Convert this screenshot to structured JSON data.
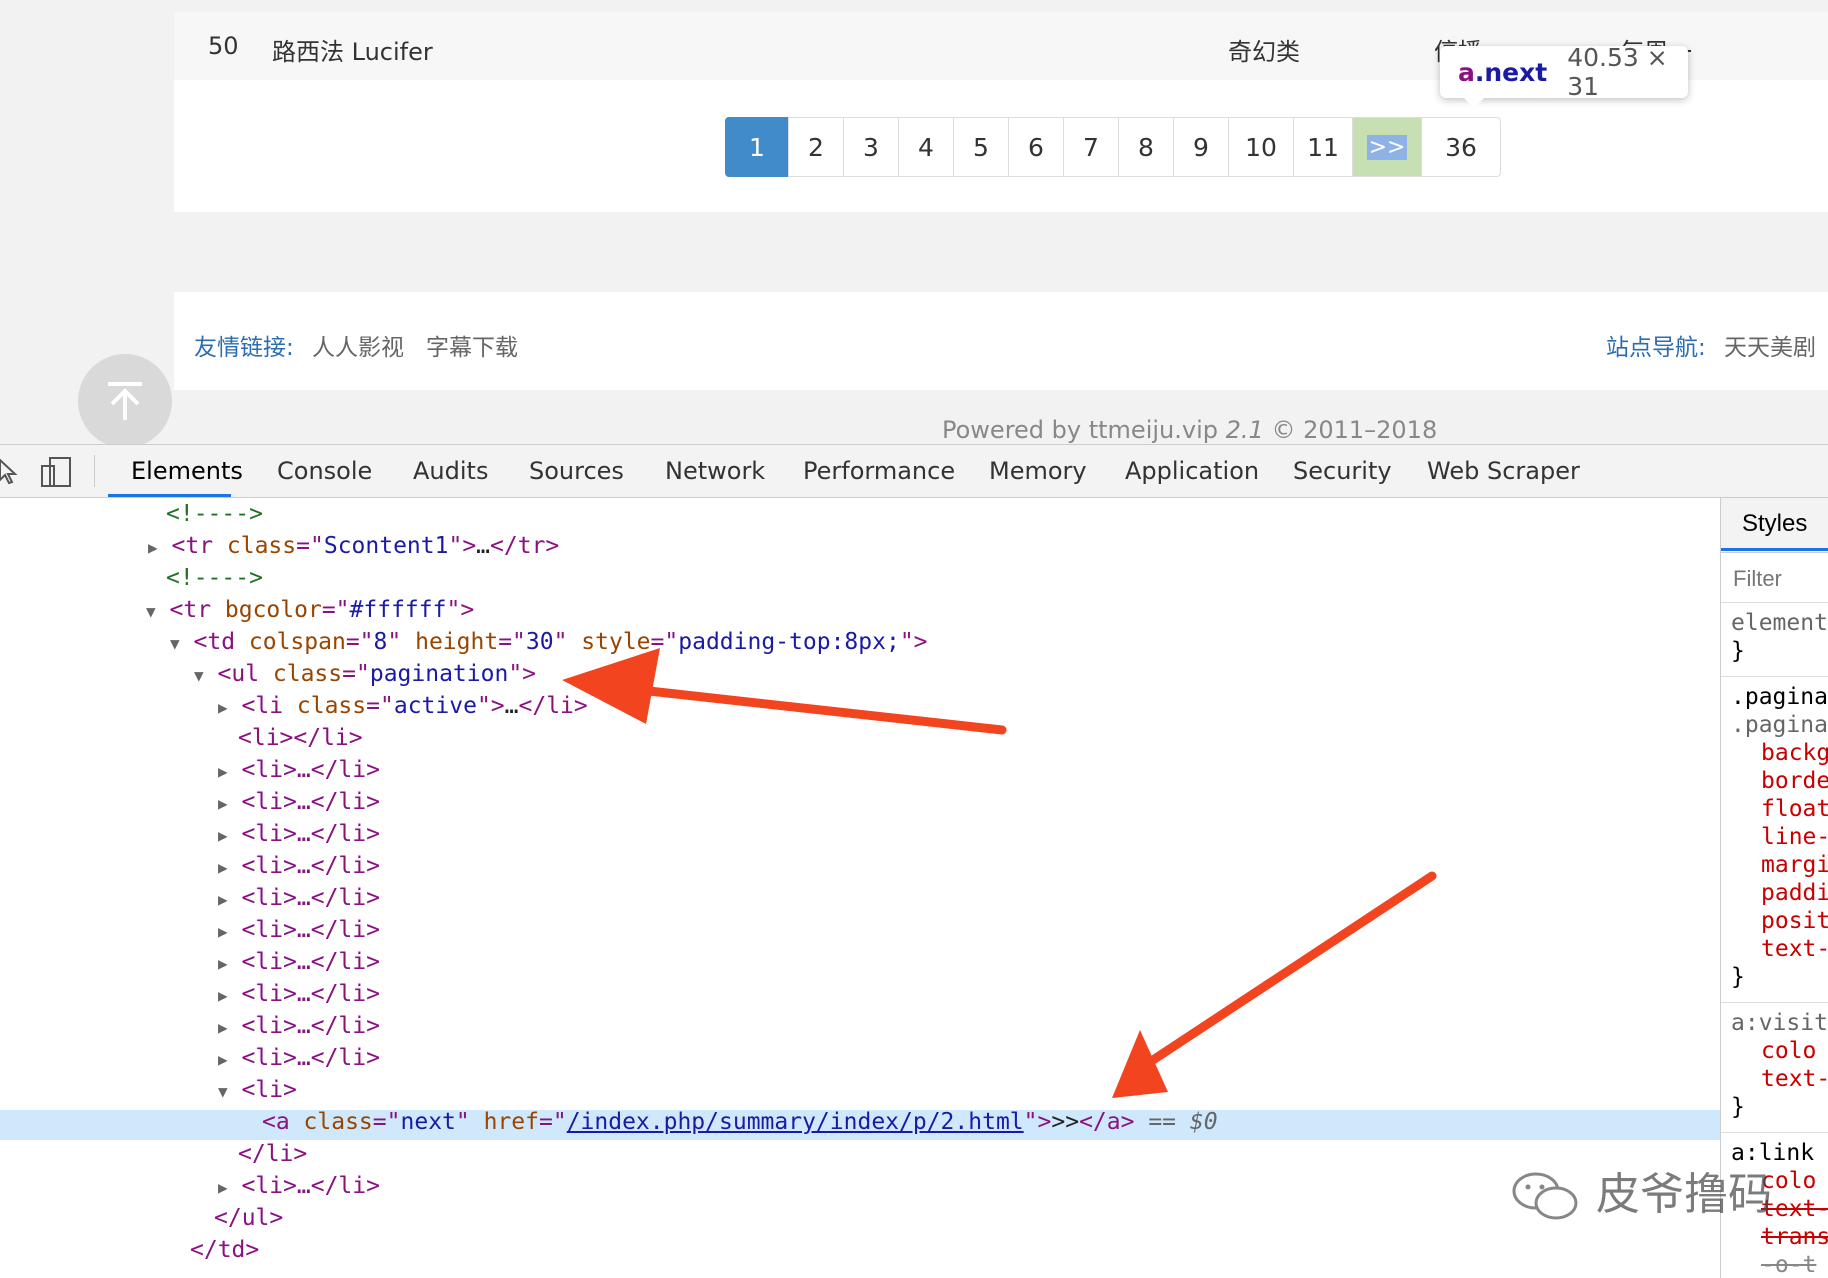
{
  "page": {
    "row": {
      "num": "50",
      "title": "路西法 Lucifer",
      "genre": "奇幻类",
      "status": "停播",
      "schedule": "每周一"
    },
    "pagination": [
      {
        "label": "1",
        "active": true
      },
      {
        "label": "2"
      },
      {
        "label": "3"
      },
      {
        "label": "4"
      },
      {
        "label": "5"
      },
      {
        "label": "6"
      },
      {
        "label": "7"
      },
      {
        "label": "8"
      },
      {
        "label": "9"
      },
      {
        "label": "10"
      },
      {
        "label": "11"
      },
      {
        "label": ">>",
        "next": true
      },
      {
        "label": "36"
      }
    ],
    "tooltip": {
      "selector_tag": "a",
      "selector_class": ".next",
      "dims": "40.53 × 31"
    },
    "friend_links_label": "友情链接:",
    "friend_links": [
      "人人影视",
      "字幕下载"
    ],
    "site_nav_label": "站点导航:",
    "site_nav": "天天美剧",
    "powered": {
      "pre": "Powered by ttmeiju.vip",
      "ver": "2.1",
      "post": "© 2011–2018"
    },
    "back_to_top_icon": "arrow-up-icon"
  },
  "devtools": {
    "tabs": [
      "Elements",
      "Console",
      "Audits",
      "Sources",
      "Network",
      "Performance",
      "Memory",
      "Application",
      "Security",
      "Web Scraper"
    ],
    "active_tab": "Elements",
    "styles_tab": "Styles",
    "filter_placeholder": "Filter",
    "dom": {
      "comment": "<!---->",
      "tr1_open": "<tr",
      "tr1_attr": "class",
      "tr1_val": "Scontent1",
      "tr1_rest": ">…</tr>",
      "tr2_attr": "bgcolor",
      "tr2_val": "#ffffff",
      "td_attr1": "colspan",
      "td_val1": "8",
      "td_attr2": "height",
      "td_val2": "30",
      "td_attr3": "style",
      "td_val3": "padding-top:8px;",
      "ul_attr": "class",
      "ul_val": "pagination",
      "li_active_attr": "class",
      "li_active_val": "active",
      "li_empty": "<li></li>",
      "li_collapsed": "<li>…</li>",
      "li_open": "<li>",
      "a_attr1": "class",
      "a_val1": "next",
      "a_attr2": "href",
      "a_href": "/index.php/summary/index/p/2.html",
      "a_text": ">>",
      "eq": "== $0",
      "li_close": "</li>",
      "ul_close": "</ul>",
      "td_close": "</td>"
    },
    "styles_lines": [
      "element.",
      "}",
      ".pagina",
      ".pagina",
      "backg",
      "borde",
      "float",
      "line-",
      "margi",
      "paddi",
      "posit",
      "text-",
      "}",
      "a:visit",
      "colo",
      "text-",
      "}",
      "a:link",
      "colo",
      "text-",
      "trans",
      "-o-t"
    ]
  },
  "watermark": "皮爷撸码",
  "colors": {
    "active_page": "#428bca",
    "highlight_row": "#cfe8fc",
    "arrow": "#f2451f"
  }
}
